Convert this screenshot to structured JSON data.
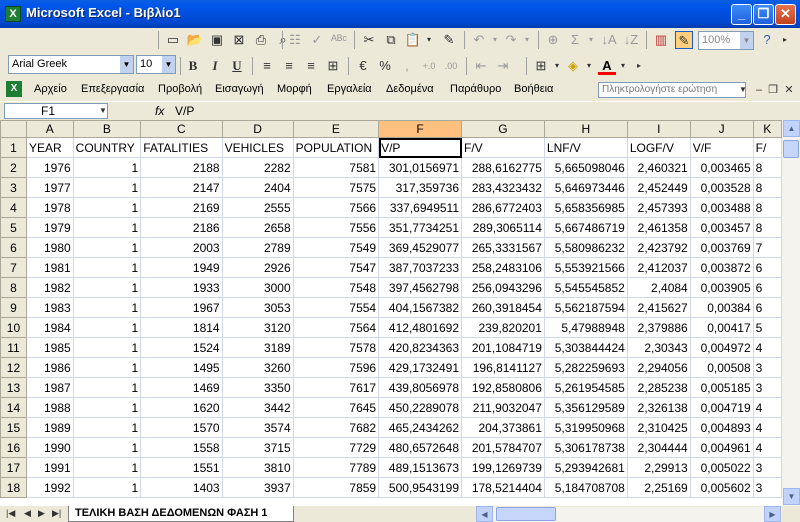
{
  "window": {
    "title": "Microsoft Excel - Βιβλίο1",
    "app_icon_letter": "X"
  },
  "toolbar": {
    "zoom": "100%",
    "font": "Arial Greek",
    "font_size": "10"
  },
  "menu": {
    "items": [
      "Αρχείο",
      "Επεξεργασία",
      "Προβολή",
      "Εισαγωγή",
      "Μορφή",
      "Εργαλεία",
      "Δεδομένα",
      "Παράθυρο",
      "Βοήθεια"
    ],
    "help_placeholder": "Πληκτρολογήστε ερώτηση"
  },
  "formula_bar": {
    "cell_ref": "F1",
    "fx": "fx",
    "content": "V/P"
  },
  "sheet": {
    "col_letters": [
      "A",
      "B",
      "C",
      "D",
      "E",
      "F",
      "G",
      "H",
      "I",
      "J",
      "K"
    ],
    "headers": [
      "YEAR",
      "COUNTRY",
      "FATALITIES",
      "VEHICLES",
      "POPULATION",
      "V/P",
      "F/V",
      "LNF/V",
      "LOGF/V",
      "V/F",
      "F/"
    ],
    "rows": [
      [
        "1976",
        "1",
        "2188",
        "2282",
        "7581",
        "301,0156971",
        "288,6162775",
        "5,665098046",
        "2,460321",
        "0,003465",
        "8"
      ],
      [
        "1977",
        "1",
        "2147",
        "2404",
        "7575",
        "317,359736",
        "283,4323432",
        "5,646973446",
        "2,452449",
        "0,003528",
        "8"
      ],
      [
        "1978",
        "1",
        "2169",
        "2555",
        "7566",
        "337,6949511",
        "286,6772403",
        "5,658356985",
        "2,457393",
        "0,003488",
        "8"
      ],
      [
        "1979",
        "1",
        "2186",
        "2658",
        "7556",
        "351,7734251",
        "289,3065114",
        "5,667486719",
        "2,461358",
        "0,003457",
        "8"
      ],
      [
        "1980",
        "1",
        "2003",
        "2789",
        "7549",
        "369,4529077",
        "265,3331567",
        "5,580986232",
        "2,423792",
        "0,003769",
        "7"
      ],
      [
        "1981",
        "1",
        "1949",
        "2926",
        "7547",
        "387,7037233",
        "258,2483106",
        "5,553921566",
        "2,412037",
        "0,003872",
        "6"
      ],
      [
        "1982",
        "1",
        "1933",
        "3000",
        "7548",
        "397,4562798",
        "256,0943296",
        "5,545545852",
        "2,4084",
        "0,003905",
        "6"
      ],
      [
        "1983",
        "1",
        "1967",
        "3053",
        "7554",
        "404,1567382",
        "260,3918454",
        "5,562187594",
        "2,415627",
        "0,00384",
        "6"
      ],
      [
        "1984",
        "1",
        "1814",
        "3120",
        "7564",
        "412,4801692",
        "239,820201",
        "5,47988948",
        "2,379886",
        "0,00417",
        "5"
      ],
      [
        "1985",
        "1",
        "1524",
        "3189",
        "7578",
        "420,8234363",
        "201,1084719",
        "5,303844424",
        "2,30343",
        "0,004972",
        "4"
      ],
      [
        "1986",
        "1",
        "1495",
        "3260",
        "7596",
        "429,1732491",
        "196,8141127",
        "5,282259693",
        "2,294056",
        "0,00508",
        "3"
      ],
      [
        "1987",
        "1",
        "1469",
        "3350",
        "7617",
        "439,8056978",
        "192,8580806",
        "5,261954585",
        "2,285238",
        "0,005185",
        "3"
      ],
      [
        "1988",
        "1",
        "1620",
        "3442",
        "7645",
        "450,2289078",
        "211,9032047",
        "5,356129589",
        "2,326138",
        "0,004719",
        "4"
      ],
      [
        "1989",
        "1",
        "1570",
        "3574",
        "7682",
        "465,2434262",
        "204,373861",
        "5,319950968",
        "2,310425",
        "0,004893",
        "4"
      ],
      [
        "1990",
        "1",
        "1558",
        "3715",
        "7729",
        "480,6572648",
        "201,5784707",
        "5,306178738",
        "2,304444",
        "0,004961",
        "4"
      ],
      [
        "1991",
        "1",
        "1551",
        "3810",
        "7789",
        "489,1513673",
        "199,1269739",
        "5,293942681",
        "2,29913",
        "0,005022",
        "3"
      ],
      [
        "1992",
        "1",
        "1403",
        "3937",
        "7859",
        "500,9543199",
        "178,5214404",
        "5,184708708",
        "2,25169",
        "0,005602",
        "3"
      ]
    ]
  },
  "sheet_tab": "ΤΕΛΙΚΗ ΒΑΣΗ ΔΕΔΟΜΕΝΩΝ ΦΑΣΗ 1"
}
